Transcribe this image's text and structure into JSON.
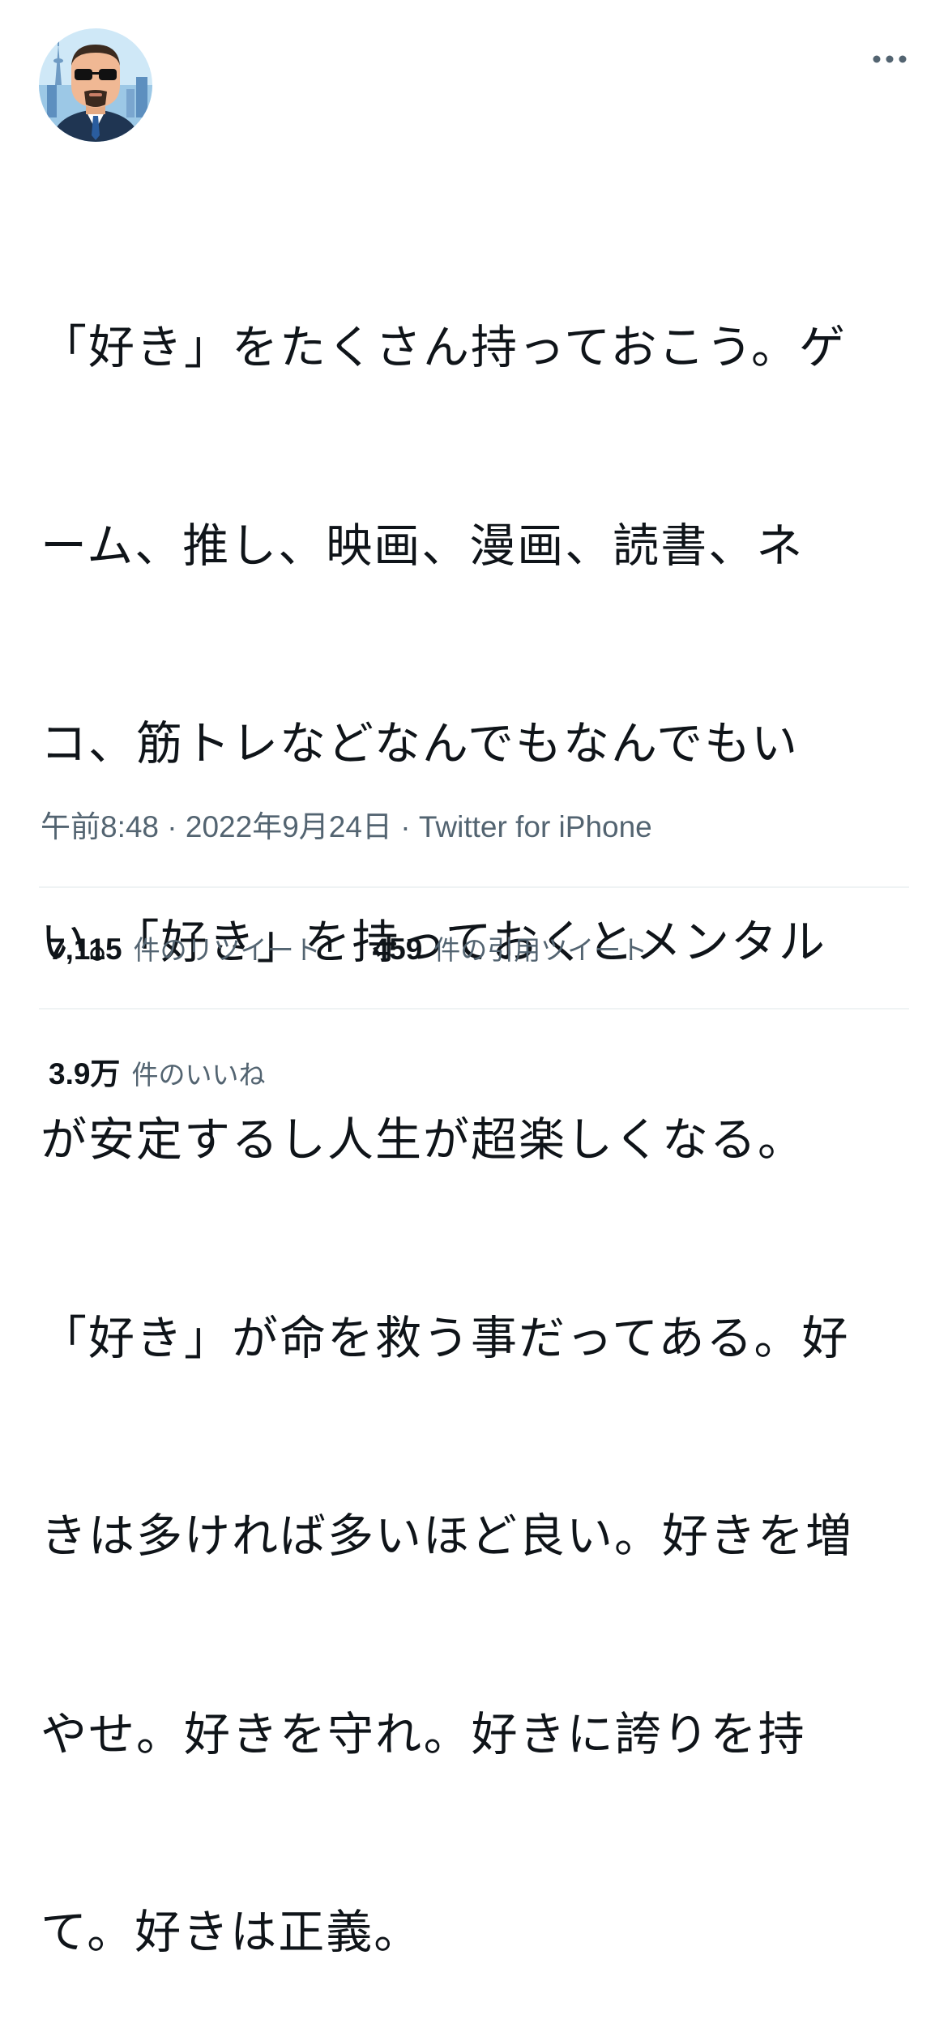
{
  "tweet": {
    "avatar_icon": "avatar-man-sunglasses-skytree",
    "more_icon": "more-horizontal-icon",
    "text_lines": [
      "「好き」をたくさん持っておこう。ゲ",
      "ーム、推し、映画、漫画、読書、ネ",
      "コ、筋トレなどなんでもなんでもい",
      "い。「好き」を持っておくとメンタル",
      "が安定するし人生が超楽しくなる。",
      "「好き」が命を救う事だってある。好",
      "きは多ければ多いほど良い。好きを増",
      "やせ。好きを守れ。好きに誇りを持",
      "て。好きは正義。"
    ],
    "time": "午前8:48",
    "separator": " · ",
    "date": "2022年9月24日",
    "source": "Twitter for iPhone"
  },
  "stats": {
    "retweets": {
      "count": "7,115",
      "label": "件のリツイート"
    },
    "quotes": {
      "count": "459",
      "label": "件の引用ツイート"
    },
    "likes": {
      "count": "3.9万",
      "label": "件のいいね"
    }
  },
  "colors": {
    "text": "#0f1419",
    "secondary": "#536471",
    "divider": "#eff3f4",
    "avatar_sky": "#b9dcf2"
  }
}
